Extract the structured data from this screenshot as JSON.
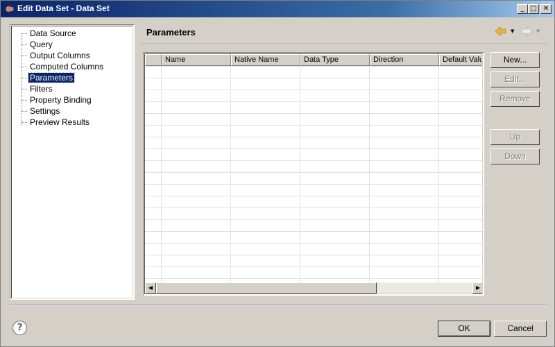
{
  "window": {
    "title": "Edit Data Set - Data Set",
    "controls": {
      "minimize": "_",
      "maximize": "□",
      "close": "✕"
    }
  },
  "nav": {
    "items": [
      {
        "label": "Data Source",
        "selected": false
      },
      {
        "label": "Query",
        "selected": false
      },
      {
        "label": "Output Columns",
        "selected": false
      },
      {
        "label": "Computed Columns",
        "selected": false
      },
      {
        "label": "Parameters",
        "selected": true
      },
      {
        "label": "Filters",
        "selected": false
      },
      {
        "label": "Property Binding",
        "selected": false
      },
      {
        "label": "Settings",
        "selected": false
      },
      {
        "label": "Preview Results",
        "selected": false
      }
    ]
  },
  "page": {
    "title": "Parameters",
    "back_icon": "back-arrow-icon",
    "forward_icon": "forward-arrow-icon"
  },
  "table": {
    "columns": [
      "Name",
      "Native Name",
      "Data Type",
      "Direction",
      "Default Value"
    ],
    "rows": []
  },
  "side_buttons": {
    "new": "New...",
    "edit": "Edit...",
    "remove": "Remove",
    "up": "Up",
    "down": "Down"
  },
  "footer": {
    "help_icon": "help-icon",
    "help_glyph": "?",
    "ok": "OK",
    "cancel": "Cancel"
  },
  "colors": {
    "titlebar_start": "#0a246a",
    "titlebar_end": "#a6caf0",
    "dialog_bg": "#d4d0c8",
    "selection": "#0a246a",
    "back_arrow": "#e8b640"
  }
}
